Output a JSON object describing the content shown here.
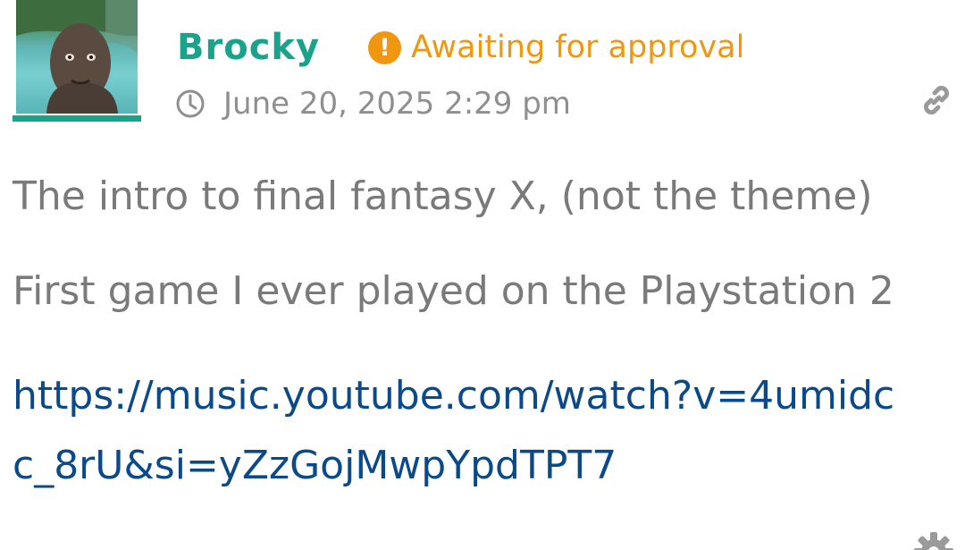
{
  "post": {
    "author": "Brocky",
    "status_label": "Awaiting for approval",
    "status_icon": "exclamation-circle-icon",
    "timestamp": "June 20, 2025 2:29 pm",
    "body_lines": [
      "The intro to final fantasy X, (not the theme)",
      "First game I ever played on the Playstation 2"
    ],
    "link_text": "https://music.youtube.com/watch?v=4umidcc_8rU&si=yZzGojMwpYpdTPT7"
  },
  "icons": {
    "clock": "clock-icon",
    "permalink": "link-icon",
    "settings": "gear-icon"
  },
  "colors": {
    "author": "#1aa38b",
    "status": "#f0960f",
    "meta": "#8f8f8f",
    "body": "#7a7a7a",
    "link": "#0b4a8a"
  }
}
